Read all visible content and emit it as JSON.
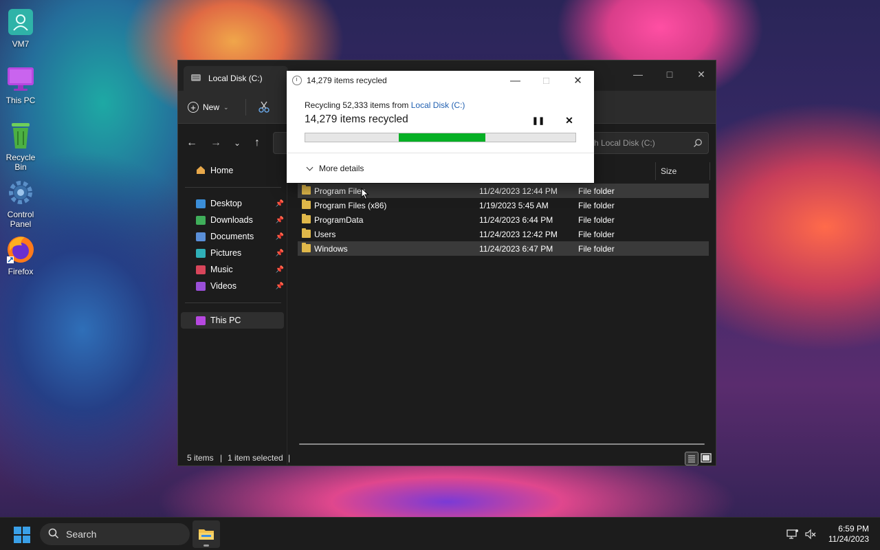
{
  "desktop": {
    "icons": [
      {
        "label": "VM7"
      },
      {
        "label": "This PC"
      },
      {
        "label": "Recycle Bin"
      },
      {
        "label": "Control Panel"
      },
      {
        "label": "Firefox"
      }
    ]
  },
  "explorer": {
    "tab_title": "Local Disk (C:)",
    "toolbar": {
      "new_label": "New"
    },
    "search_placeholder": "Search Local Disk (C:)",
    "search_visible": "h Local Disk (C:)",
    "sidebar": {
      "home": "Home",
      "quick": [
        {
          "label": "Desktop",
          "color": "#3b8ed8"
        },
        {
          "label": "Downloads",
          "color": "#3fae5a"
        },
        {
          "label": "Documents",
          "color": "#5a8fd8"
        },
        {
          "label": "Pictures",
          "color": "#2fb0b8"
        },
        {
          "label": "Music",
          "color": "#d8455a"
        },
        {
          "label": "Videos",
          "color": "#9a4fd8"
        }
      ],
      "this_pc": "This PC"
    },
    "columns": {
      "size": "Size"
    },
    "rows": [
      {
        "name": "Program Files",
        "date": "11/24/2023 12:44 PM",
        "type": "File folder"
      },
      {
        "name": "Program Files (x86)",
        "date": "1/19/2023 5:45 AM",
        "type": "File folder"
      },
      {
        "name": "ProgramData",
        "date": "11/24/2023 6:44 PM",
        "type": "File folder"
      },
      {
        "name": "Users",
        "date": "11/24/2023 12:42 PM",
        "type": "File folder"
      },
      {
        "name": "Windows",
        "date": "11/24/2023 6:47 PM",
        "type": "File folder"
      }
    ],
    "status": {
      "count": "5 items",
      "selected": "1 item selected"
    }
  },
  "dialog": {
    "title": "14,279 items recycled",
    "from_prefix": "Recycling 52,333 items from",
    "from_link": "Local Disk (C:)",
    "big_status": "14,279 items recycled",
    "more_details": "More details",
    "progress": {
      "start": 0.345,
      "end": 0.665
    },
    "bar_color": "#06b025"
  },
  "taskbar": {
    "search_label": "Search",
    "time": "6:59 PM",
    "date": "11/24/2023"
  },
  "icons": [
    "user-icon",
    "monitor-icon",
    "trash-icon",
    "gear-icon",
    "firefox-icon",
    "cut-icon",
    "folder-icon",
    "pin-icon",
    "search-icon",
    "windows-logo-icon"
  ]
}
